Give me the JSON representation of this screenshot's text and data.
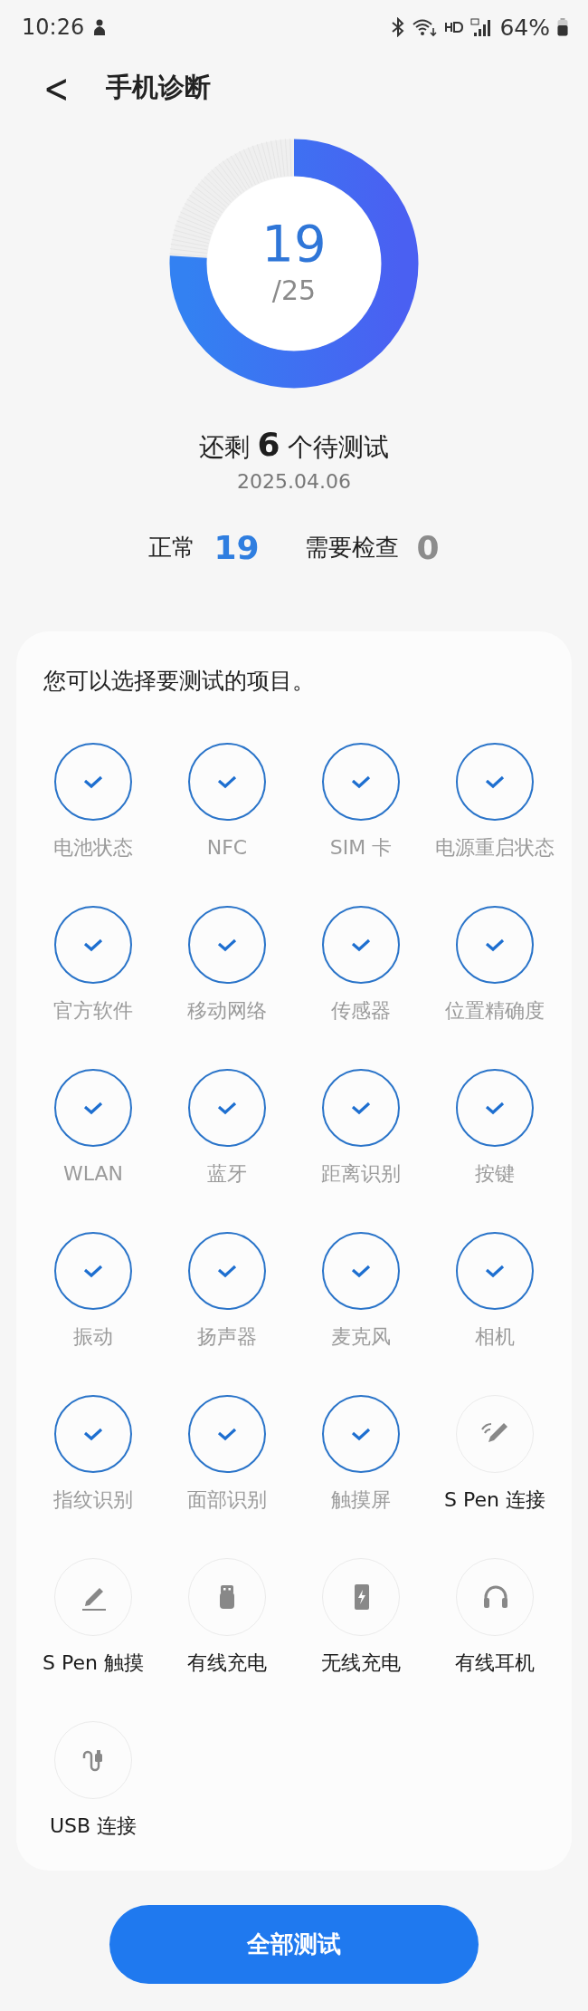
{
  "status_bar": {
    "time": "10:26",
    "battery": "64%"
  },
  "header": {
    "back": "<",
    "title": "手机诊断"
  },
  "score": {
    "passed": "19",
    "total": "/25",
    "level": 0.76
  },
  "summary": {
    "remaining": "还剩 **6** 个待测试",
    "date": "2025.04.06"
  },
  "stats": [
    {
      "label": "正常",
      "count": "19",
      "kind": "ok"
    },
    {
      "label": "需要检查",
      "count": "0",
      "kind": "issue"
    }
  ],
  "test_card": {
    "prompt": "您可以选择要测试的项目。",
    "items": [
      {
        "label": "电池状态",
        "tested": true
      },
      {
        "label": "NFC",
        "tested": true
      },
      {
        "label": "SIM 卡",
        "tested": true
      },
      {
        "label": "电源重启状态",
        "tested": true
      },
      {
        "label": "官方软件",
        "tested": true
      },
      {
        "label": "移动网络",
        "tested": true
      },
      {
        "label": "传感器",
        "tested": true
      },
      {
        "label": "位置精确度",
        "tested": true
      },
      {
        "label": "WLAN",
        "tested": true
      },
      {
        "label": "蓝牙",
        "tested": true
      },
      {
        "label": "距离识别",
        "tested": true
      },
      {
        "label": "按键",
        "tested": true
      },
      {
        "label": "振动",
        "tested": true
      },
      {
        "label": "扬声器",
        "tested": true
      },
      {
        "label": "麦克风",
        "tested": true
      },
      {
        "label": "相机",
        "tested": true
      },
      {
        "label": "指纹识别",
        "tested": true
      },
      {
        "label": "面部识别",
        "tested": true
      },
      {
        "label": "触摸屏",
        "tested": true
      },
      {
        "label": "S Pen 连接",
        "tested": false
      },
      {
        "label": "S Pen 触摸",
        "tested": false
      },
      {
        "label": "有线充电",
        "tested": false
      },
      {
        "label": "无线充电",
        "tested": false
      },
      {
        "label": "有线耳机",
        "tested": false
      },
      {
        "label": "USB 连接",
        "tested": false
      }
    ]
  },
  "action_button": {
    "label": "全部测试"
  }
}
